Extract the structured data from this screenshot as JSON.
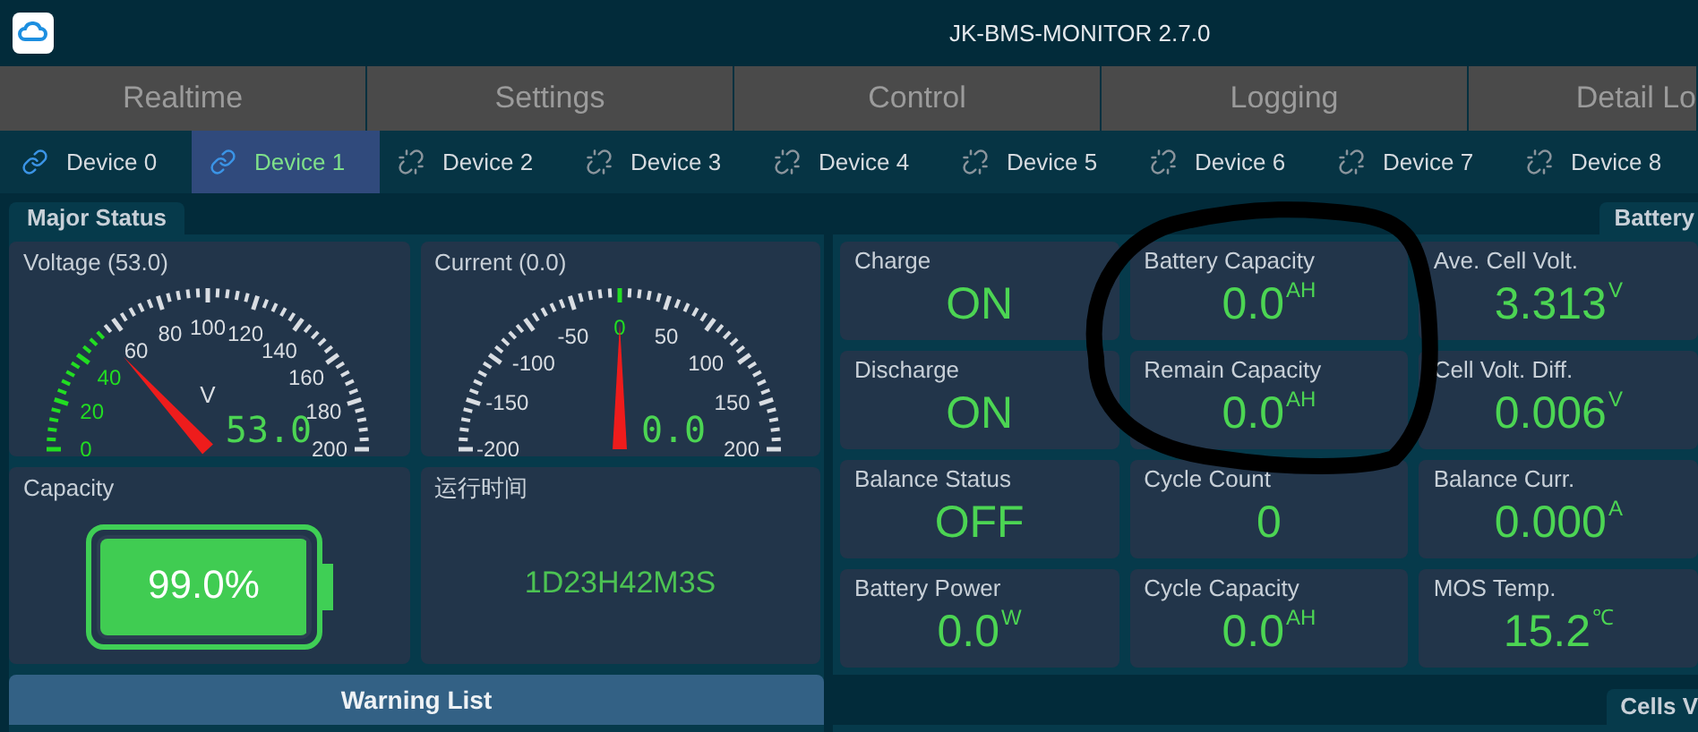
{
  "window": {
    "title": "JK-BMS-MONITOR 2.7.0"
  },
  "tabs": [
    {
      "label": "Realtime",
      "selected": false
    },
    {
      "label": "Settings",
      "selected": false
    },
    {
      "label": "Control",
      "selected": false
    },
    {
      "label": "Logging",
      "selected": false
    },
    {
      "label": "Detail Lo",
      "selected": false
    }
  ],
  "devices": [
    {
      "label": "Device 0",
      "connected": true,
      "selected": false
    },
    {
      "label": "Device 1",
      "connected": true,
      "selected": true
    },
    {
      "label": "Device 2",
      "connected": false,
      "selected": false
    },
    {
      "label": "Device 3",
      "connected": false,
      "selected": false
    },
    {
      "label": "Device 4",
      "connected": false,
      "selected": false
    },
    {
      "label": "Device 5",
      "connected": false,
      "selected": false
    },
    {
      "label": "Device 6",
      "connected": false,
      "selected": false
    },
    {
      "label": "Device 7",
      "connected": false,
      "selected": false
    },
    {
      "label": "Device 8",
      "connected": false,
      "selected": false
    }
  ],
  "major_status": {
    "title": "Major Status",
    "gauges": [
      {
        "kind": "unipolar",
        "title": "Voltage (53.0)",
        "unit": "V",
        "reading": "53.0",
        "ticks": [
          "0",
          "20",
          "40",
          "60",
          "80",
          "100",
          "120",
          "140",
          "160",
          "180",
          "200"
        ]
      },
      {
        "kind": "bipolar",
        "title": "Current (0.0)",
        "reading": "0.0",
        "ticks": [
          "-200",
          "-150",
          "-100",
          "-50",
          "0",
          "50",
          "100",
          "150",
          "200"
        ]
      }
    ],
    "capacity": {
      "title": "Capacity",
      "reading": "99.0%",
      "level": 0.99
    },
    "runtime": {
      "title": "运行时间",
      "value": "1D23H42M3S"
    },
    "warning_list": {
      "title": "Warning List"
    }
  },
  "battery": {
    "title": "Battery",
    "cards": [
      {
        "label": "Charge",
        "value": "ON"
      },
      {
        "label": "Battery Capacity",
        "value": "0.0",
        "unit": "AH"
      },
      {
        "label": "Ave. Cell Volt.",
        "value": "3.313",
        "unit": "V"
      },
      {
        "label": "Discharge",
        "value": "ON"
      },
      {
        "label": "Remain Capacity",
        "value": "0.0",
        "unit": "AH"
      },
      {
        "label": "Cell Volt. Diff.",
        "value": "0.006",
        "unit": "V"
      },
      {
        "label": "Balance Status",
        "value": "OFF"
      },
      {
        "label": "Cycle Count",
        "value": "0"
      },
      {
        "label": "Balance Curr.",
        "value": "0.000",
        "unit": "A"
      },
      {
        "label": "Battery Power",
        "value": "0.0",
        "unit": "W"
      },
      {
        "label": "Cycle Capacity",
        "value": "0.0",
        "unit": "AH"
      },
      {
        "label": "MOS Temp.",
        "value": "15.2",
        "unit": "℃"
      }
    ]
  },
  "cells": {
    "title": "Cells V"
  }
}
